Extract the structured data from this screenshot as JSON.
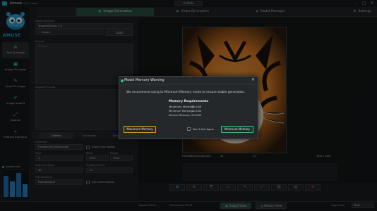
{
  "app": {
    "title": "Amuse",
    "version": "v3.2.1 beta",
    "mode_pill": "Mode",
    "logo_text": "AMUSE"
  },
  "window_controls": [
    "–",
    "□",
    "✕"
  ],
  "top_tabs": [
    {
      "label": "Image Generation",
      "active": true
    },
    {
      "label": "Video Generation",
      "active": false
    },
    {
      "label": "Model Manager",
      "active": false
    }
  ],
  "settings_label": "Settings",
  "nav": [
    {
      "label": "Text To Image",
      "icon": "A",
      "active": true
    },
    {
      "label": "Image To Image",
      "icon": "▣",
      "active": false
    },
    {
      "label": "Paint To Image",
      "icon": "✎",
      "active": false
    },
    {
      "label": "Image Inpaint",
      "icon": "✐",
      "active": false
    },
    {
      "label": "Upscale",
      "icon": "⤢",
      "active": false
    },
    {
      "label": "Feature Extractor",
      "icon": "⌖",
      "active": false
    }
  ],
  "system_info_label": "System Info",
  "left_panel": {
    "model_label": "Model Selection",
    "model_value": "StableDiffusion 3.5",
    "sub_option": "Unload",
    "sub_load": "Load",
    "prompt_label": "Prompt",
    "prompt_placeholder": "Prompt",
    "negative_label": "Negative Prompt",
    "settings_tabs": [
      "Options",
      "Advanced",
      "Batch Mode"
    ],
    "scheduler_label": "Scheduler",
    "scheduler_value": "FlowMatchEulerDiscrete",
    "enable_live_update": "Enable Live Update",
    "seed_label": "Seed",
    "seed_value": "0",
    "width_label": "Width",
    "width_value": "1024",
    "height_label": "Height",
    "height_value": "1024",
    "inference_label": "Inference Steps",
    "guidance_label": "Guidance Scale",
    "steps_value": "40",
    "guidance_value": "3.5",
    "vae_label": "VAE Scheduler",
    "vae_value": "ModelDefault",
    "use_karras": "Use Karras Sigmas",
    "cancel_button": "Cancel",
    "generate_button": "Generate"
  },
  "image_meta": {
    "scheduler": "FlowMatchEulerDiscrete",
    "steps": "40",
    "guidance": "3.5",
    "seed": "",
    "size": "1024 / 1024"
  },
  "bottom_bar": {
    "elapsed_label": "Elapsed",
    "elapsed_value": "00:4.1",
    "performance_label": "Performance",
    "performance_value": "07:43",
    "output_view": "Output View",
    "history_view": "History View",
    "output_size_label": "Output Size",
    "output_size_value": "Both"
  },
  "dialog": {
    "title": "Model Memory Warning",
    "message": "We recommend using to Minimum Memory mode to ensure stable generation.",
    "requirements_title": "Memory Requirements",
    "rows": [
      {
        "label": "Maximum Memory:",
        "value": "38.0GB"
      },
      {
        "label": "Minimum Memory:",
        "value": "24.0GB"
      },
      {
        "label": "Device Memory:",
        "value": "24.0GB"
      }
    ],
    "max_button": "Maximum Memory",
    "min_button": "Minimum Memory",
    "dont_ask": "Don't Ask Again"
  },
  "colors": {
    "accent_green": "#3ac07e",
    "accent_blue": "#1f6fb2",
    "max_memory_border": "#d8a21f",
    "active_tab_bg": "#2b4d42"
  }
}
